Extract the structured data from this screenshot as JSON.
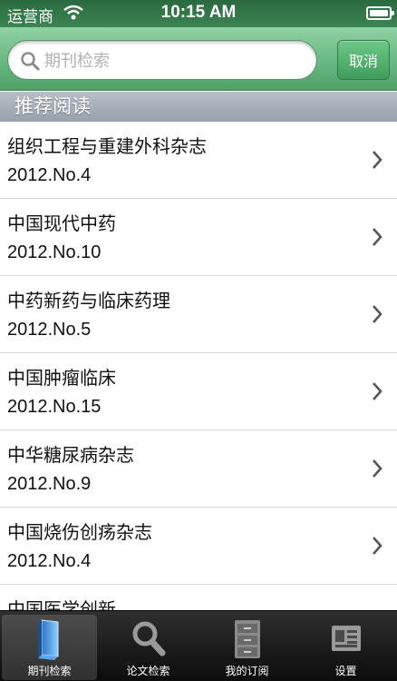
{
  "status_bar": {
    "carrier": "运营商",
    "time": "10:15 AM"
  },
  "search": {
    "placeholder": "期刊检索",
    "value": "",
    "cancel_label": "取消"
  },
  "section": {
    "title": "推荐阅读"
  },
  "journals": [
    {
      "title": "组织工程与重建外科杂志",
      "issue": "2012.No.4"
    },
    {
      "title": "中国现代中药",
      "issue": "2012.No.10"
    },
    {
      "title": "中药新药与临床药理",
      "issue": "2012.No.5"
    },
    {
      "title": "中国肿瘤临床",
      "issue": "2012.No.15"
    },
    {
      "title": "中华糖尿病杂志",
      "issue": "2012.No.9"
    },
    {
      "title": "中国烧伤创疡杂志",
      "issue": "2012.No.4"
    },
    {
      "title": "中国医学创新",
      "issue": ""
    }
  ],
  "tabs": [
    {
      "label": "期刊检索",
      "icon": "book-icon",
      "active": true
    },
    {
      "label": "论文检索",
      "icon": "magnifier-icon",
      "active": false
    },
    {
      "label": "我的订阅",
      "icon": "cabinet-icon",
      "active": false
    },
    {
      "label": "设置",
      "icon": "contact-card-icon",
      "active": false
    }
  ],
  "colors": {
    "accent_green": "#4f9f69",
    "header_gray": "#a7b0b9",
    "tab_bar": "#1a1a1a"
  }
}
